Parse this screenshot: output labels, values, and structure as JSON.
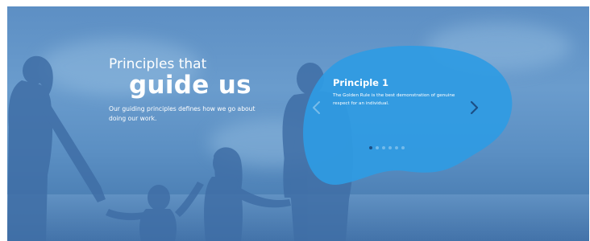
{
  "hero": {
    "heading_line1": "Principles that",
    "heading_line2": "guide us",
    "description": "Our guiding principles defines how we go about doing our work."
  },
  "carousel": {
    "slide_title": "Principle 1",
    "slide_text": "The Golden Rule is the best demonstration of genuine respect for an individual.",
    "prev_icon": "chevron-left-icon",
    "next_icon": "chevron-right-icon",
    "slide_count": 6,
    "active_index": 0
  },
  "colors": {
    "overlay": "#5b8fc3",
    "bubble": "#2f9be3",
    "active_dot": "#1c4f86",
    "text": "#ffffff"
  }
}
